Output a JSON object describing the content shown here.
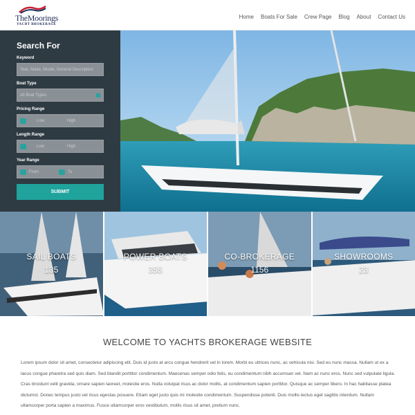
{
  "header": {
    "logo_name": "TheMoorings",
    "logo_sub": "YACHT BROKERAGE",
    "nav": [
      "Home",
      "Boats For Sale",
      "Crew Page",
      "Blog",
      "About",
      "Contact Us"
    ]
  },
  "search": {
    "title": "Search For",
    "keyword_label": "Keyword",
    "keyword_placeholder": "Year, Make, Model, General Description",
    "boat_type_label": "Boat Type",
    "boat_type_value": "All Boat Types",
    "pricing_label": "Pricing Range",
    "pricing_low": "Low",
    "pricing_high": "High",
    "length_label": "Length Range",
    "length_low": "Low",
    "length_high": "High",
    "year_label": "Year Range",
    "year_from": "From",
    "year_to": "To",
    "submit_label": "SUBMIT"
  },
  "categories": [
    {
      "title": "SAIL BOATS",
      "count": "135"
    },
    {
      "title": "POWER BOATS",
      "count": "355"
    },
    {
      "title": "CO-BROKERAGE",
      "count": "1156"
    },
    {
      "title": "SHOWROOMS",
      "count": "23"
    }
  ],
  "welcome": {
    "title": "WELCOME TO YACHTS BROKERAGE WEBSITE",
    "body": "Lorem ipsum dolor sit amet, consectetur adipiscing elit. Duis id justo at arcu congue hendrerit vel in lorem. Morbi eu ultrices nunc, ac vehicula nisi. Sed eu nunc massa. Nullam ut ex a lacus congue pharetra sed quis diam. Sed blandit porttitor condimentum. Maecenas semper odio felis, eu condimentum nibh accumsan vel. Nam ac nunc eros. Nunc sed vulputate ligula. Cras tincidunt velit gravida, ornare sapien laoreet, molestie eros. Nulla volutpat risus ac dolor mollis, at condimentum sapien porttitor. Quisque ac semper libero. In hac habitasse platea dictumst. Donec tempus justo vel risus egestas posuere. Etiam eget justo quis mi molestie condimentum. Suspendisse potenti. Duis mollis lectus eget sagittis interdum. Nullam ullamcorper porta sapien a maximus. Fusce ullamcorper eros vestibulum, mollis risus sit amet, pretium nunc."
  },
  "colors": {
    "accent": "#1fa39c",
    "panel": "#2f3b43",
    "brand": "#1d2a5a"
  }
}
